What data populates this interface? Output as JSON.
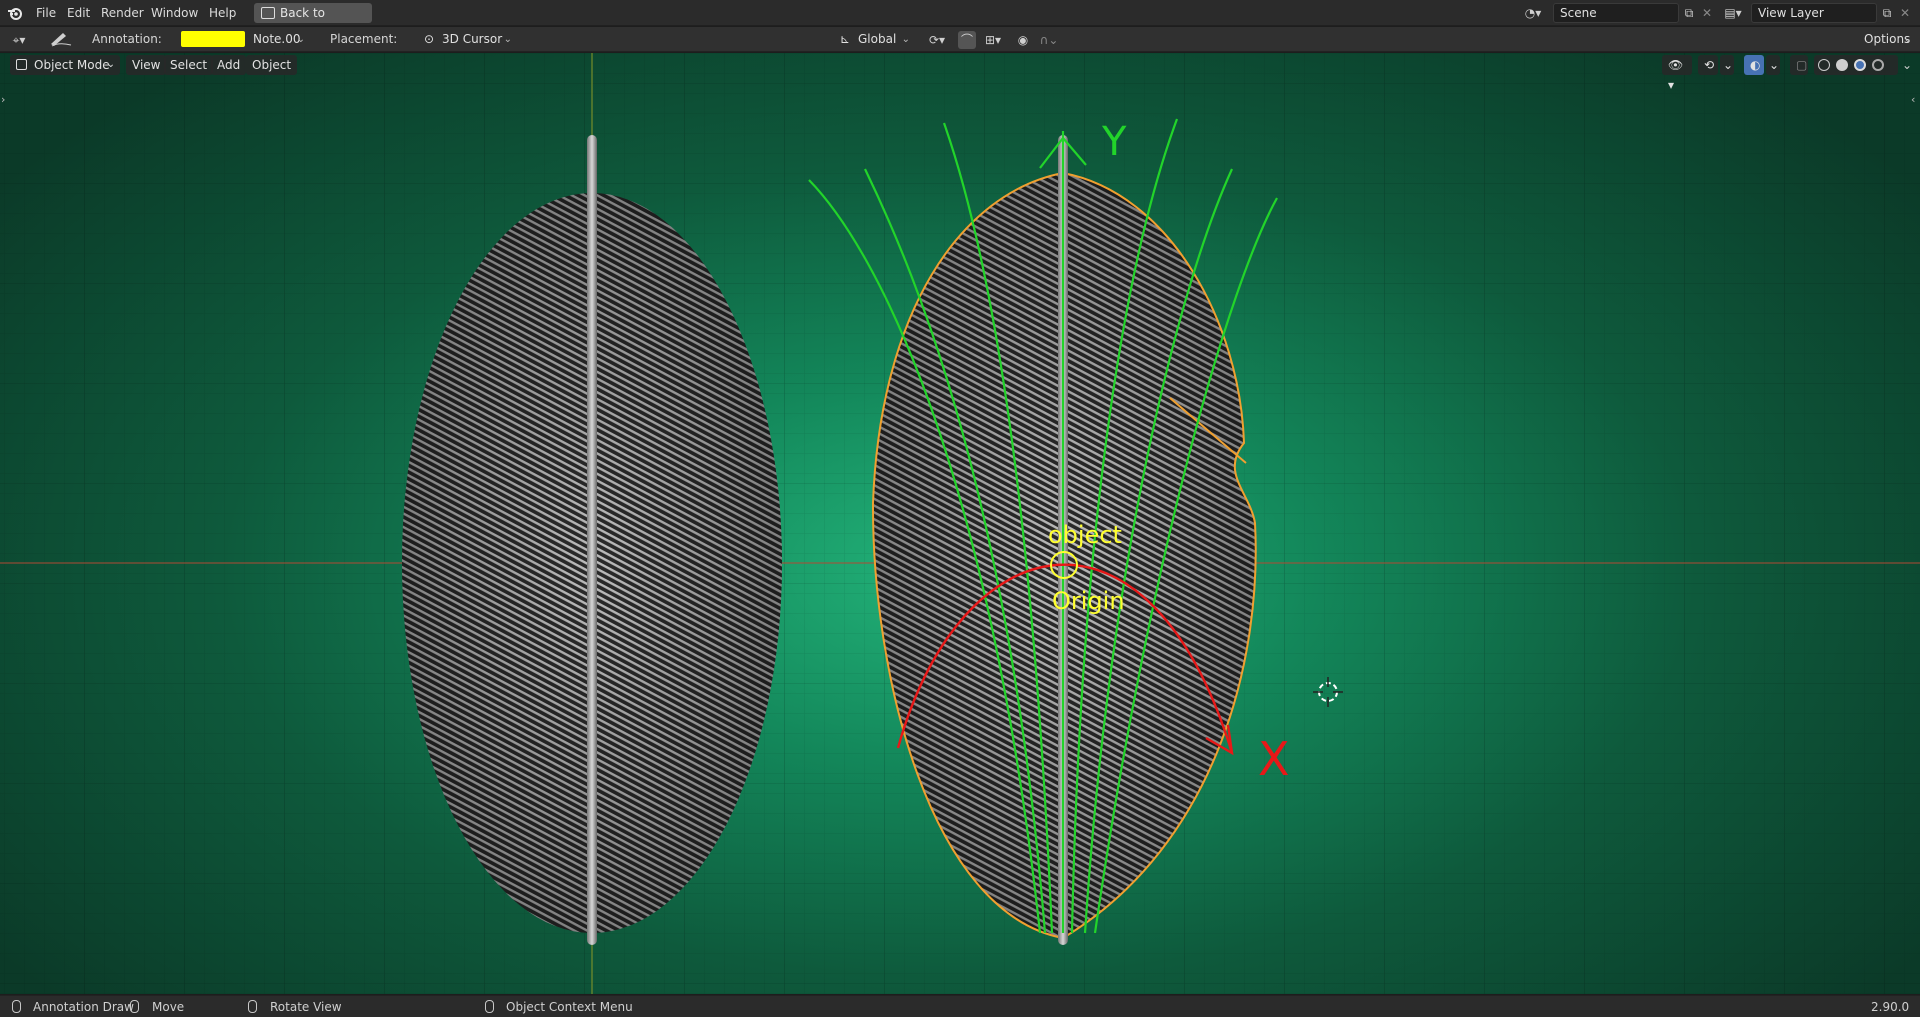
{
  "menubar": {
    "items": [
      "File",
      "Edit",
      "Render",
      "Window",
      "Help"
    ],
    "back_button": "Back to Previous",
    "scene": "Scene",
    "view_layer": "View Layer"
  },
  "toolheader": {
    "annotation_label": "Annotation:",
    "annotation_color": "#ffff00",
    "note_layer": "Note.00",
    "placement_label": "Placement:",
    "placement_value": "3D Cursor",
    "orientation": "Global",
    "options": "Options"
  },
  "viewport_header": {
    "mode": "Object Mode",
    "menus": [
      "View",
      "Select",
      "Add",
      "Object"
    ]
  },
  "viewport": {
    "annotations": {
      "origin_text_1": "object",
      "origin_text_2": "Origin",
      "axis_y": "Y",
      "axis_x": "X"
    },
    "colors": {
      "background": "#13875a",
      "green_annot": "#22d42a",
      "red_annot": "#e81818",
      "yellow_annot": "#ffff30",
      "selection_outline": "#f0a030"
    }
  },
  "statusbar": {
    "items": [
      "Annotation Draw",
      "Move",
      "Rotate View",
      "Object Context Menu"
    ],
    "version": "2.90.0"
  }
}
